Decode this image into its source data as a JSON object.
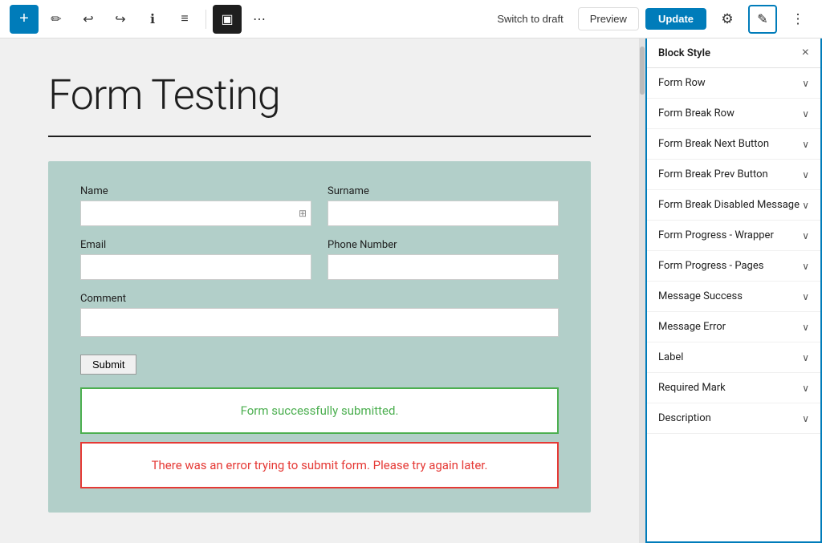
{
  "toolbar": {
    "add_icon": "+",
    "draw_icon": "✏",
    "undo_icon": "↩",
    "redo_icon": "↪",
    "info_icon": "ℹ",
    "list_icon": "≡",
    "view_icon": "▣",
    "more_icon": "⋯",
    "switch_draft_label": "Switch to draft",
    "preview_label": "Preview",
    "update_label": "Update",
    "settings_icon": "⚙",
    "edit_icon": "✎",
    "options_icon": "⋮"
  },
  "editor": {
    "form_title": "Form Testing",
    "form": {
      "name_label": "Name",
      "surname_label": "Surname",
      "email_label": "Email",
      "phone_label": "Phone Number",
      "comment_label": "Comment",
      "submit_label": "Submit",
      "success_message": "Form successfully submitted.",
      "error_message": "There was an error trying to submit form. Please try again later."
    }
  },
  "panel": {
    "title": "Block Style",
    "close_icon": "×",
    "items": [
      {
        "label": "Form Row",
        "chevron": "∨"
      },
      {
        "label": "Form Break Row",
        "chevron": "∨"
      },
      {
        "label": "Form Break Next Button",
        "chevron": "∨"
      },
      {
        "label": "Form Break Prev Button",
        "chevron": "∨"
      },
      {
        "label": "Form Break Disabled Message",
        "chevron": "∨"
      },
      {
        "label": "Form Progress - Wrapper",
        "chevron": "∨"
      },
      {
        "label": "Form Progress - Pages",
        "chevron": "∨"
      },
      {
        "label": "Message Success",
        "chevron": "∨"
      },
      {
        "label": "Message Error",
        "chevron": "∨"
      },
      {
        "label": "Label",
        "chevron": "∨"
      },
      {
        "label": "Required Mark",
        "chevron": "∨"
      },
      {
        "label": "Description",
        "chevron": "∨"
      }
    ]
  }
}
